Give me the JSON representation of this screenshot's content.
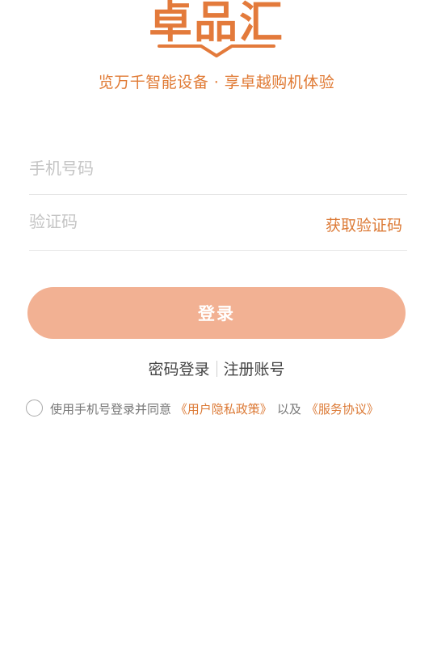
{
  "brand": {
    "logo_text": "卓品汇",
    "tagline": "览万千智能设备 · 享卓越购机体验"
  },
  "form": {
    "phone_placeholder": "手机号码",
    "code_placeholder": "验证码",
    "get_code_label": "获取验证码",
    "login_label": "登录"
  },
  "alt_links": {
    "password_login": "密码登录",
    "register": "注册账号"
  },
  "agreement": {
    "checked": false,
    "prefix": "使用手机号登录并同意",
    "privacy_policy": "《用户隐私政策》",
    "conjunction": "以及",
    "service_agreement": "《服务协议》"
  },
  "colors": {
    "accent": "#e07a34",
    "login_button": "#f2b193",
    "placeholder": "#c4c4c4",
    "divider": "#e6e6e6"
  }
}
